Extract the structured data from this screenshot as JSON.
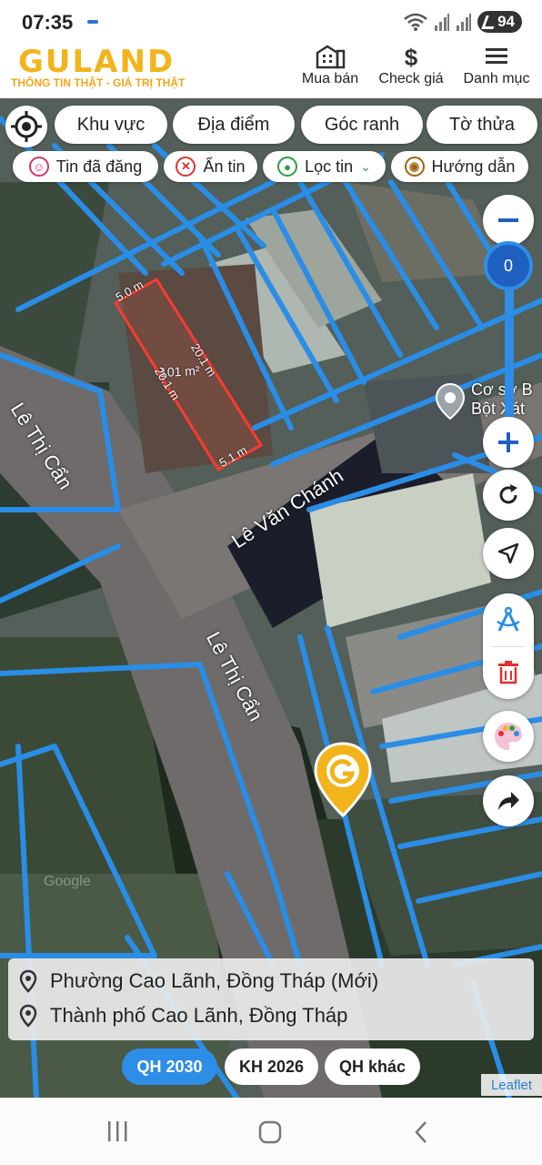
{
  "status": {
    "time": "07:35",
    "battery": "94"
  },
  "header": {
    "logo": "GULAND",
    "tagline": "THÔNG TIN THẬT - GIÁ TRỊ THẬT",
    "buttons": [
      {
        "label": "Mua bán",
        "icon": "building-icon"
      },
      {
        "label": "Check giá",
        "icon": "dollar-icon"
      },
      {
        "label": "Danh mục",
        "icon": "menu-icon"
      }
    ]
  },
  "filters": {
    "primary": [
      "Khu vực",
      "Địa điểm",
      "Góc ranh",
      "Tờ thửa"
    ],
    "secondary": [
      {
        "label": "Tin đã đăng",
        "color": "#d6336c"
      },
      {
        "label": "Ẩn tin",
        "color": "#e03131"
      },
      {
        "label": "Lọc tin",
        "color": "#2f9e44"
      },
      {
        "label": "Hướng dẫn",
        "color": "#a0640c"
      }
    ]
  },
  "map": {
    "zoom_level": "0",
    "streets": [
      "Lê Thị Cẩn",
      "Lê Văn Chánh",
      "Lê Thị Cẩn"
    ],
    "parcel": {
      "area": "101 m²",
      "side_top": "5.0 m",
      "side_right": "20.1 m",
      "side_left": "20.1 m",
      "side_bottom": "5.1 m",
      "border_color": "#ff3b30"
    },
    "poi": [
      "Cơ sở B",
      "Bột Xát"
    ],
    "watermark": "Google"
  },
  "address": {
    "new": "Phường Cao Lãnh, Đồng Tháp (Mới)",
    "old": "Thành phố Cao Lãnh, Đồng Tháp"
  },
  "tabs": [
    {
      "label": "QH 2030",
      "active": true
    },
    {
      "label": "KH 2026",
      "active": false
    },
    {
      "label": "QH khác",
      "active": false
    }
  ],
  "attribution": "Leaflet",
  "colors": {
    "brand": "#f2b41a",
    "accent": "#2e8de6",
    "parcel": "#ff3b30"
  }
}
